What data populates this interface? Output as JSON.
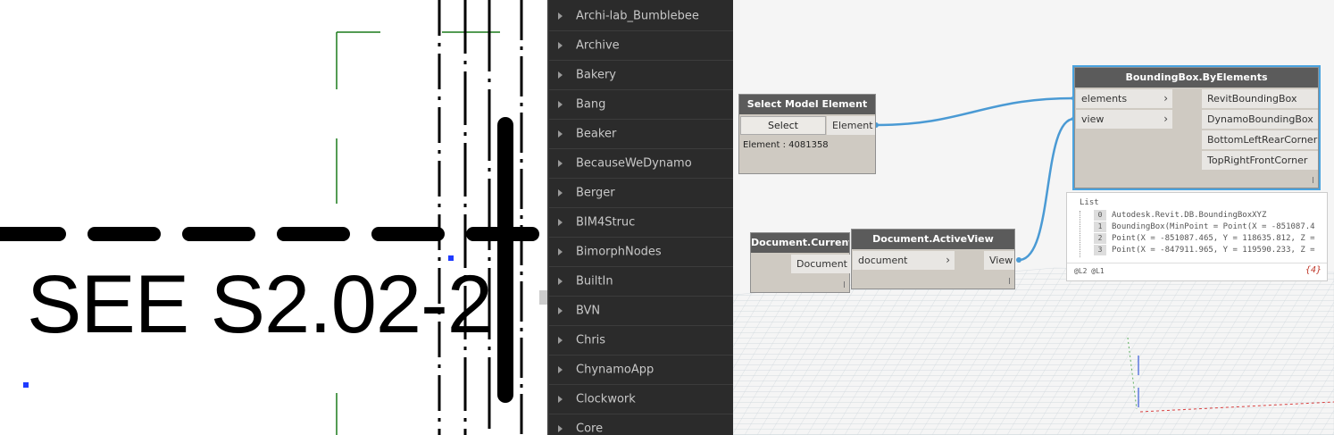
{
  "revit": {
    "annotation": "SEE S2.02-2"
  },
  "library": {
    "items": [
      {
        "label": "Archi-lab_Bumblebee"
      },
      {
        "label": "Archive"
      },
      {
        "label": "Bakery"
      },
      {
        "label": "Bang"
      },
      {
        "label": "Beaker"
      },
      {
        "label": "BecauseWeDynamo"
      },
      {
        "label": "Berger"
      },
      {
        "label": "BIM4Struc"
      },
      {
        "label": "BimorphNodes"
      },
      {
        "label": "BuiltIn"
      },
      {
        "label": "BVN"
      },
      {
        "label": "Chris"
      },
      {
        "label": "ChynamoApp"
      },
      {
        "label": "Clockwork"
      },
      {
        "label": "Core"
      }
    ]
  },
  "nodes": {
    "select_model": {
      "title": "Select Model Element",
      "button": "Select",
      "output": "Element",
      "info": "Element : 4081358"
    },
    "doc_current": {
      "title": "Document.Current",
      "output": "Document"
    },
    "doc_activeview": {
      "title": "Document.ActiveView",
      "input": "document",
      "output": "View"
    },
    "bbox": {
      "title": "BoundingBox.ByElements",
      "inputs": [
        "elements",
        "view"
      ],
      "outputs": [
        "RevitBoundingBox",
        "DynamoBoundingBox",
        "BottomLeftRearCorner",
        "TopRightFrontCorner"
      ]
    }
  },
  "preview": {
    "header": "List",
    "rows": [
      {
        "index": "0",
        "text": "Autodesk.Revit.DB.BoundingBoxXYZ"
      },
      {
        "index": "1",
        "text": "BoundingBox(MinPoint = Point(X = -851087.4"
      },
      {
        "index": "2",
        "text": "Point(X = -851087.465, Y = 118635.812, Z ="
      },
      {
        "index": "3",
        "text": "Point(X = -847911.965, Y = 119590.233, Z ="
      }
    ],
    "levels": "@L2 @L1",
    "count": "{4}"
  },
  "colors": {
    "wire": "#4a9ad4",
    "node_title": "#5b5b5b",
    "node_body": "#cfcac2",
    "library_bg": "#2b2b2b",
    "selection": "#4aa3df"
  }
}
